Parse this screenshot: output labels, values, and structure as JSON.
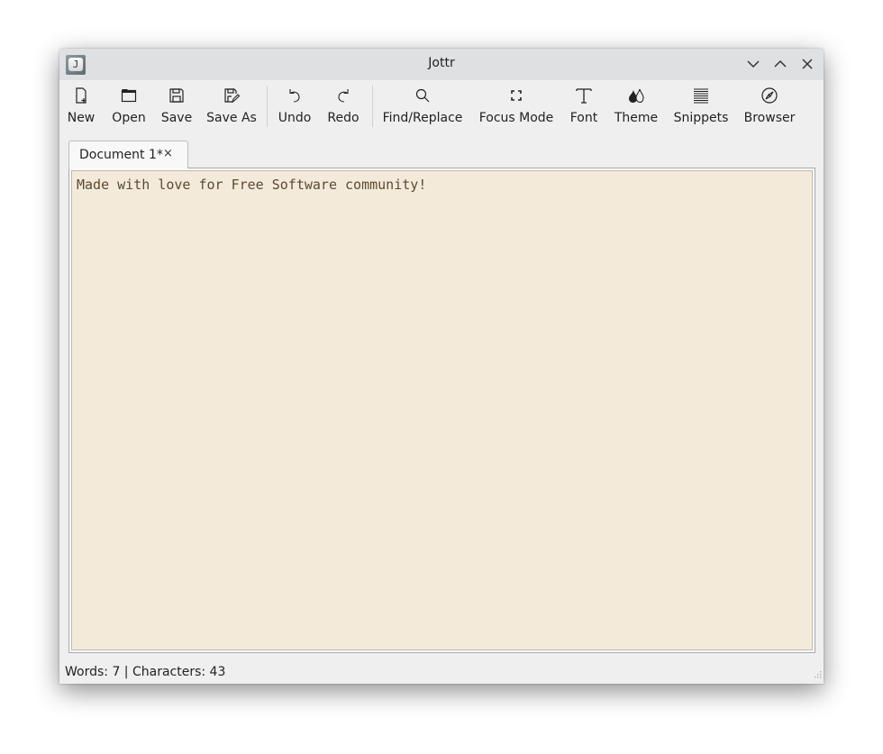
{
  "window": {
    "title": "Jottr",
    "app_icon_letter": "J",
    "controls": [
      "minimize",
      "maximize",
      "close"
    ]
  },
  "toolbar": {
    "items": [
      {
        "label": "New",
        "icon": "new-file-icon"
      },
      {
        "label": "Open",
        "icon": "folder-open-icon"
      },
      {
        "label": "Save",
        "icon": "save-icon"
      },
      {
        "label": "Save As",
        "icon": "save-as-icon"
      },
      {
        "label": "Undo",
        "icon": "undo-icon"
      },
      {
        "label": "Redo",
        "icon": "redo-icon"
      },
      {
        "label": "Find/Replace",
        "icon": "search-icon"
      },
      {
        "label": "Focus Mode",
        "icon": "fullscreen-icon"
      },
      {
        "label": "Font",
        "icon": "font-icon"
      },
      {
        "label": "Theme",
        "icon": "theme-drops-icon"
      },
      {
        "label": "Snippets",
        "icon": "snippets-lines-icon"
      },
      {
        "label": "Browser",
        "icon": "compass-icon"
      }
    ]
  },
  "tabs": [
    {
      "label": "Document 1*",
      "close": "×",
      "active": true
    }
  ],
  "editor": {
    "content": "Made with love for Free Software community!",
    "background": "#f3ead9",
    "text_color": "#5b4a34"
  },
  "status": {
    "text": "Words: 7 | Characters: 43"
  }
}
